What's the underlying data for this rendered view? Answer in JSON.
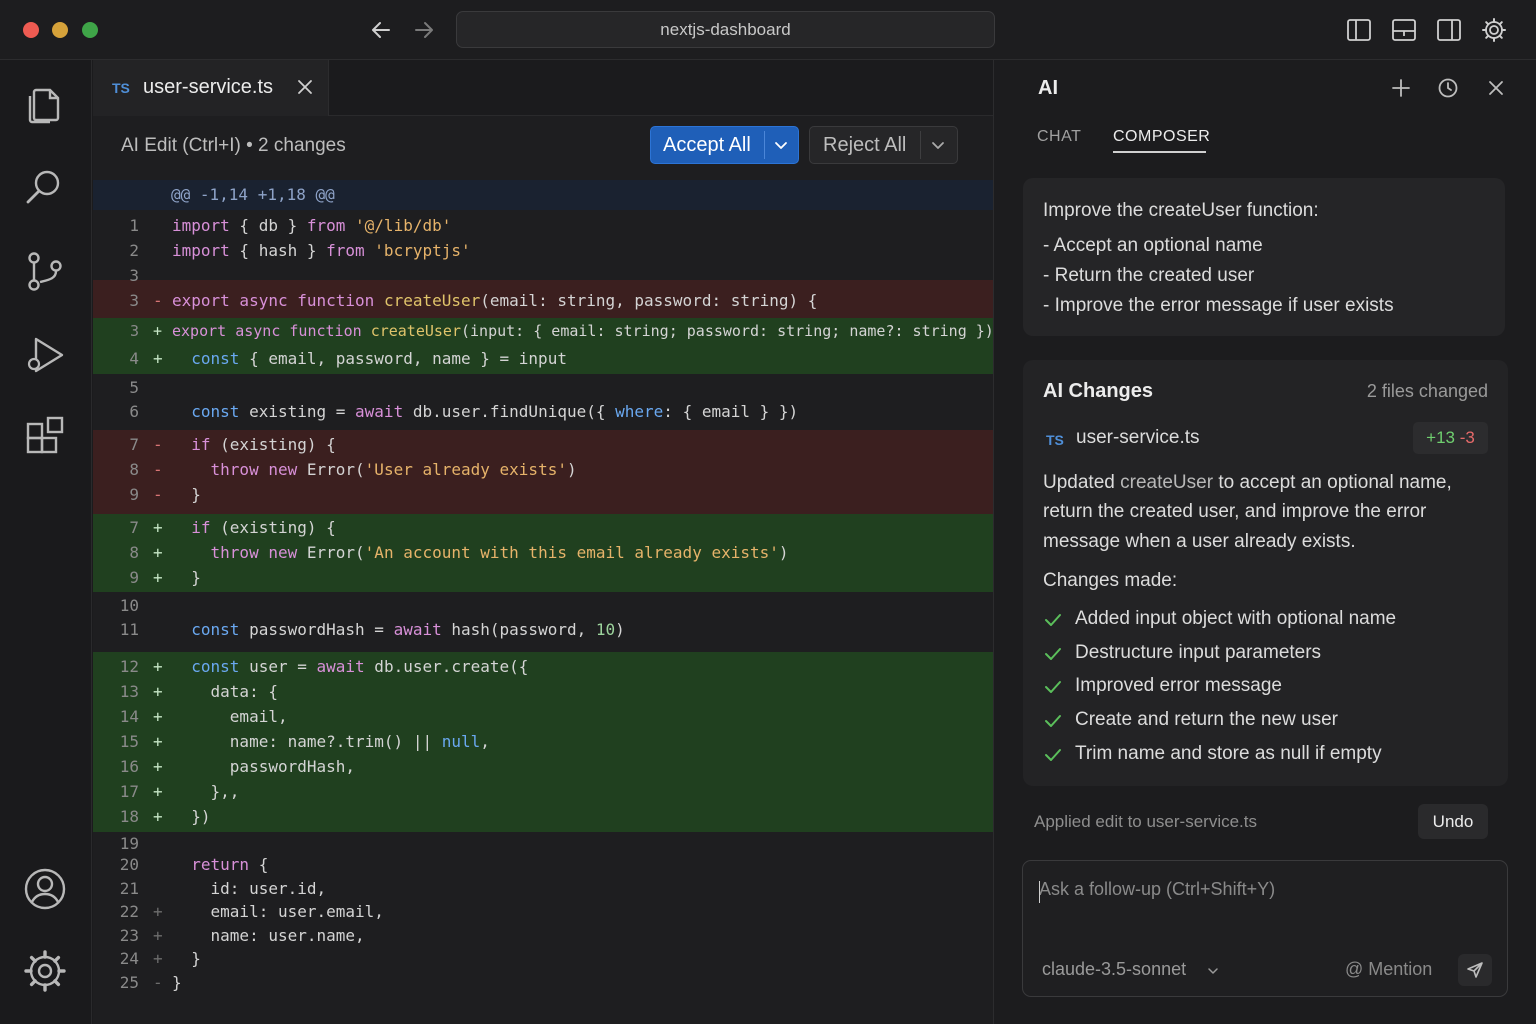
{
  "window": {
    "title": "nextjs-dashboard"
  },
  "colors": {
    "accent": "#1f5fb8",
    "added": "#20401f",
    "removed": "#3b1f1f",
    "diff_add_text": "#6fcf6f",
    "diff_del_text": "#e66a6a"
  },
  "activity_bar": {
    "items": [
      "files-icon",
      "search-icon",
      "source-control-icon",
      "run-debug-icon",
      "extensions-icon"
    ],
    "bottom": [
      "account-icon",
      "settings-icon"
    ]
  },
  "editor": {
    "tab": {
      "lang": "TS",
      "filename": "user-service.ts"
    },
    "edit_bar": {
      "label": "AI Edit (Ctrl+I) • 2 changes",
      "accept": "Accept All",
      "reject": "Reject All"
    },
    "hunk_header": "@@ -1,14 +1,18 @@"
  },
  "ai_panel": {
    "title": "AI",
    "tabs": [
      "CHAT",
      "COMPOSER"
    ],
    "active_tab": "COMPOSER",
    "prompt": {
      "line1": "Improve the createUser function:",
      "line2": "- Accept an optional name",
      "line3": "- Return the created user",
      "line4": "- Improve the error message if user exists"
    },
    "changes": {
      "title": "AI Changes",
      "count": "2 files changed",
      "file_lang": "TS",
      "file_name": "user-service.ts",
      "added": "+13",
      "removed": "-3",
      "summary_pre": "Updated ",
      "summary_code": "createUser",
      "summary_post1": " to accept an optional name,",
      "summary_line2": "return the created user, and improve the error",
      "summary_line3": "message when a user already exists.",
      "list_label": "Changes made:",
      "items": [
        "Added input object with optional name",
        "Destructure input parameters",
        "Improved error message",
        "Create and return the new user",
        "Trim name and store as null if empty"
      ]
    },
    "applied": "Applied edit to user-service.ts",
    "undo": "Undo",
    "followup": {
      "placeholder": "Ask a follow-up (Ctrl+Shift+Y)",
      "model": "claude-3.5-sonnet",
      "mention": "@ Mention"
    }
  }
}
